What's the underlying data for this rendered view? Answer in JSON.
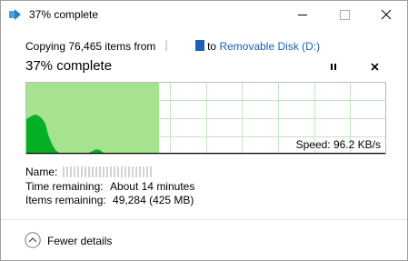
{
  "window": {
    "title": "37% complete",
    "icons": {
      "app": "copy-arrow-icon",
      "minimize": "minimize-icon",
      "maximize": "maximize-icon",
      "close": "close-icon"
    }
  },
  "copy": {
    "prefix": "Copying 76,465 items from",
    "to_word": "to",
    "destination": "Removable Disk (D:)"
  },
  "progress": {
    "header": "37% complete",
    "fraction": 0.37,
    "pause_icon": "pause-icon",
    "stop_icon": "stop-icon"
  },
  "graph": {
    "speed_label": "Speed: 96.2 KB/s",
    "fill_color": "#a6e38e",
    "line_color": "#06b025",
    "grid_color": "#bfe8c0"
  },
  "details": {
    "name_label": "Name:",
    "time_label": "Time remaining:",
    "time_value": "About 14 minutes",
    "items_label": "Items remaining:",
    "items_value": "49,284 (425 MB)"
  },
  "footer": {
    "fewer_label": "Fewer details",
    "icon": "chevron-up-circle-icon"
  }
}
